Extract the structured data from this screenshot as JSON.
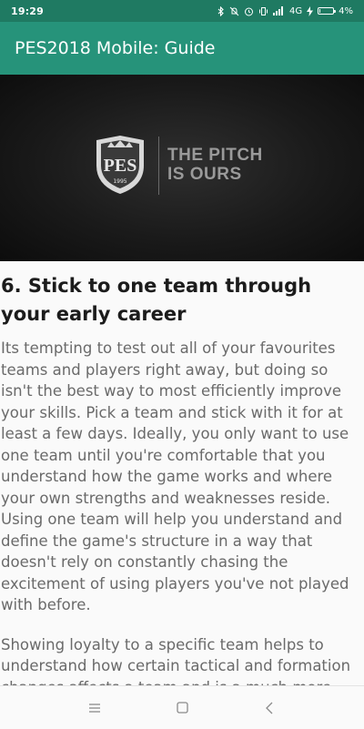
{
  "status_bar": {
    "time": "19:29",
    "network": "4G",
    "battery_percent": "4%",
    "battery_level": 0.04,
    "icons": [
      "bluetooth-icon",
      "mute-icon",
      "alarm-icon",
      "vibrate-icon",
      "signal-icon",
      "charging-icon",
      "battery-icon"
    ]
  },
  "app_bar": {
    "title": "PES2018 Mobile: Guide"
  },
  "hero": {
    "logo_year": "1995",
    "tagline_line1": "THE PITCH",
    "tagline_line2": "IS OURS"
  },
  "article": {
    "heading": "6. Stick to one team through your early career",
    "paragraphs": [
      "Its tempting to test out all of your favourites teams and players right away, but doing so isn't the best way to most efficiently improve your skills. Pick a team and stick with it for at least a few days. Ideally, you only want to use one team until you're comfortable that you understand how the game works and where your own strengths and weaknesses reside. Using one team will help you understand and define the game's structure in a way that doesn't rely on constantly chasing the excitement of using players you've not played with before.",
      "Showing loyalty to a specific team helps to understand how certain tactical and formation changes affects a team and is a much more effective means of coming up with new ways to win without relying on new or better players."
    ]
  },
  "nav_bar": {
    "buttons": [
      "menu-icon",
      "home-icon",
      "back-icon"
    ]
  },
  "colors": {
    "status_bar": "#1f7a62",
    "app_bar": "#26937a",
    "heading_text": "#1c1c1c",
    "body_text": "#6a6a6a",
    "background": "#fafafa"
  }
}
